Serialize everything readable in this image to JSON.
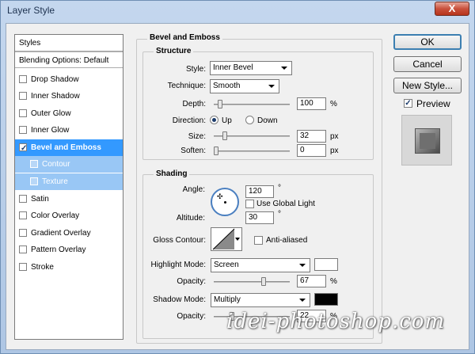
{
  "window": {
    "title": "Layer Style",
    "close_glyph": "X"
  },
  "styles_list": {
    "header": "Styles",
    "blending": "Blending Options: Default",
    "items": [
      {
        "label": "Drop Shadow",
        "checked": false
      },
      {
        "label": "Inner Shadow",
        "checked": false
      },
      {
        "label": "Outer Glow",
        "checked": false
      },
      {
        "label": "Inner Glow",
        "checked": false
      },
      {
        "label": "Bevel and Emboss",
        "checked": true
      },
      {
        "label": "Contour",
        "checked": false
      },
      {
        "label": "Texture",
        "checked": false
      },
      {
        "label": "Satin",
        "checked": false
      },
      {
        "label": "Color Overlay",
        "checked": false
      },
      {
        "label": "Gradient Overlay",
        "checked": false
      },
      {
        "label": "Pattern Overlay",
        "checked": false
      },
      {
        "label": "Stroke",
        "checked": false
      }
    ]
  },
  "bevel": {
    "section_title": "Bevel and Emboss",
    "structure": {
      "title": "Structure",
      "style_label": "Style:",
      "style_value": "Inner Bevel",
      "technique_label": "Technique:",
      "technique_value": "Smooth",
      "depth_label": "Depth:",
      "depth_value": "100",
      "depth_unit": "%",
      "depth_pos": 0.05,
      "direction_label": "Direction:",
      "dir_up": "Up",
      "dir_down": "Down",
      "size_label": "Size:",
      "size_value": "32",
      "size_unit": "px",
      "size_pos": 0.12,
      "soften_label": "Soften:",
      "soften_value": "0",
      "soften_unit": "px",
      "soften_pos": 0.0
    },
    "shading": {
      "title": "Shading",
      "angle_label": "Angle:",
      "angle_value": "120",
      "angle_unit": "°",
      "global_light": "Use Global Light",
      "altitude_label": "Altitude:",
      "altitude_value": "30",
      "altitude_unit": "°",
      "gloss_label": "Gloss Contour:",
      "anti_aliased": "Anti-aliased",
      "highlight_label": "Highlight Mode:",
      "highlight_value": "Screen",
      "highlight_color": "#ffffff",
      "hop_label": "Opacity:",
      "hop_value": "67",
      "hop_unit": "%",
      "hop_pos": 0.67,
      "shadow_label": "Shadow Mode:",
      "shadow_value": "Multiply",
      "shadow_color": "#000000",
      "sop_label": "Opacity:",
      "sop_value": "22",
      "sop_unit": "%",
      "sop_pos": 0.22
    }
  },
  "buttons": {
    "ok": "OK",
    "cancel": "Cancel",
    "new_style": "New Style...",
    "preview": "Preview"
  },
  "watermark": "idei-photoshop.com"
}
